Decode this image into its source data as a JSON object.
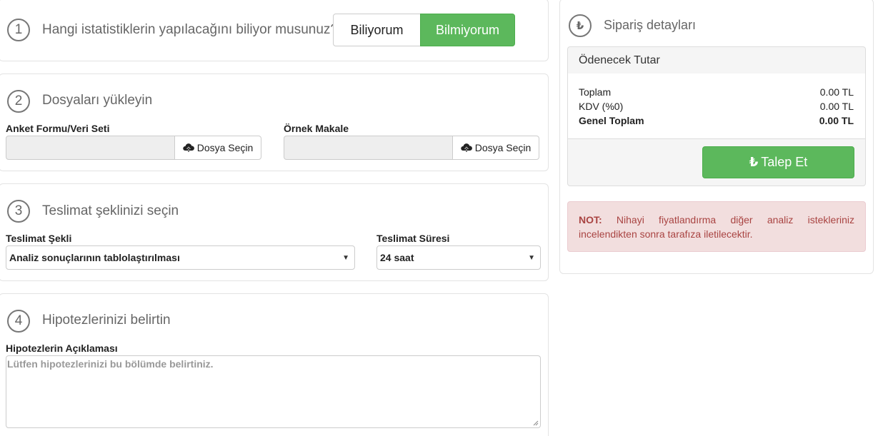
{
  "step1": {
    "number": "1",
    "question": "Hangi istatistiklerin yapılacağını biliyor musunuz?",
    "option_know": "Biliyorum",
    "option_dont_know": "Bilmiyorum",
    "selected": "Bilmiyorum"
  },
  "step2": {
    "number": "2",
    "title": "Dosyaları yükleyin",
    "dataset_label": "Anket Formu/Veri Seti",
    "article_label": "Örnek Makale",
    "choose_file_label": "Dosya Seçin"
  },
  "step3": {
    "number": "3",
    "title": "Teslimat şeklinizi seçin",
    "method_label": "Teslimat Şekli",
    "method_value": "Analiz sonuçlarının tablolaştırılması",
    "duration_label": "Teslimat Süresi",
    "duration_value": "24 saat"
  },
  "step4": {
    "number": "4",
    "title": "Hipotezlerinizi belirtin",
    "description_label": "Hipotezlerin Açıklaması",
    "description_placeholder": "Lütfen hipotezlerinizi bu bölümde belirtiniz."
  },
  "order": {
    "icon_glyph": "₺",
    "title": "Sipariş detayları",
    "amount_header": "Ödenecek Tutar",
    "rows": [
      {
        "label": "Toplam",
        "value": "0.00 TL"
      },
      {
        "label": "KDV (%0)",
        "value": "0.00 TL"
      },
      {
        "label": "Genel Toplam",
        "value": "0.00 TL"
      }
    ],
    "submit_icon": "₺",
    "submit_label": "Talep Et"
  },
  "note": {
    "prefix": "NOT:",
    "text": " Nihayi fiyatlandırma diğer analiz istekleriniz incelendikten sonra tarafıza iletilecektir."
  },
  "colors": {
    "accent_green": "#5cb85c",
    "note_bg": "#f2dede",
    "note_text": "#a94442"
  }
}
